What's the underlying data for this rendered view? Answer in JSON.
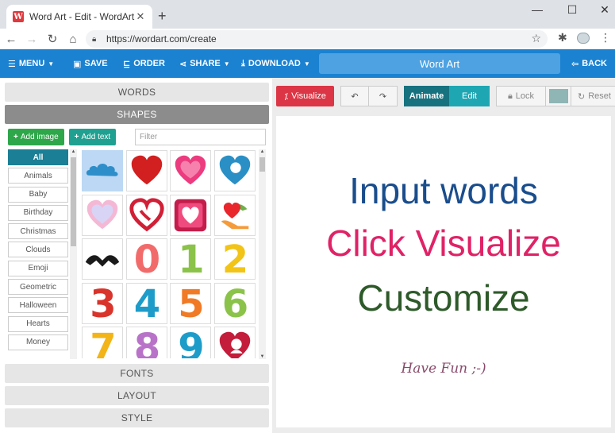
{
  "browser": {
    "tab_title": "Word Art - Edit - WordArt.com",
    "favicon_letter": "W",
    "url": "https://wordart.com/create"
  },
  "navbar": {
    "menu": "MENU",
    "save": "SAVE",
    "order": "ORDER",
    "share": "SHARE",
    "download": "DOWNLOAD",
    "title": "Word Art",
    "back": "BACK",
    "color": "#1b82d1"
  },
  "left": {
    "sections": {
      "words": "WORDS",
      "shapes": "SHAPES",
      "fonts": "FONTS",
      "layout": "LAYOUT",
      "style": "STYLE"
    },
    "add_image": "Add image",
    "add_text": "Add text",
    "filter_placeholder": "Filter",
    "categories": [
      "All",
      "Animals",
      "Baby",
      "Birthday",
      "Christmas",
      "Clouds",
      "Emoji",
      "Geometric",
      "Halloween",
      "Hearts",
      "Money"
    ],
    "selected_category": "All",
    "shapes": [
      {
        "icon": "cloud-icon",
        "selected": true
      },
      {
        "icon": "red-heart-icon"
      },
      {
        "icon": "pink-heart-icon"
      },
      {
        "icon": "blue-heart-icon"
      },
      {
        "icon": "outlined-heart-icon"
      },
      {
        "icon": "swirl-heart-icon"
      },
      {
        "icon": "framed-heart-icon"
      },
      {
        "icon": "hands-heart-icon"
      },
      {
        "icon": "hand-heart-gesture-icon"
      },
      {
        "icon": "digit-0-icon",
        "digit": "0",
        "color": "#f26b6b"
      },
      {
        "icon": "digit-1-icon",
        "digit": "1",
        "color": "#8bc34a"
      },
      {
        "icon": "digit-2-icon",
        "digit": "2",
        "color": "#f2c417"
      },
      {
        "icon": "digit-3-icon",
        "digit": "3",
        "color": "#d9342b"
      },
      {
        "icon": "digit-4-icon",
        "digit": "4",
        "color": "#1e9cc9"
      },
      {
        "icon": "digit-5-icon",
        "digit": "5",
        "color": "#f07a25"
      },
      {
        "icon": "digit-6-icon",
        "digit": "6",
        "color": "#8bc34a"
      },
      {
        "icon": "digit-7-icon",
        "digit": "7",
        "color": "#f2b417"
      },
      {
        "icon": "digit-8-icon",
        "digit": "8",
        "color": "#b873c9"
      },
      {
        "icon": "digit-9-icon",
        "digit": "9",
        "color": "#1e9cc9"
      },
      {
        "icon": "heart-silhouette-icon"
      }
    ]
  },
  "right": {
    "visualize": "Visualize",
    "animate": "Animate",
    "edit": "Edit",
    "lock": "Lock",
    "reset": "Reset",
    "swatch_color": "#8fb5b5",
    "canvas_lines": [
      {
        "text": "Input words",
        "color": "#1a4d8c"
      },
      {
        "text": "Click Visualize",
        "color": "#e02266"
      },
      {
        "text": "Customize",
        "color": "#2e5a2a"
      },
      {
        "text": "Have Fun ;-)",
        "color": "#8a4a6a"
      }
    ]
  }
}
